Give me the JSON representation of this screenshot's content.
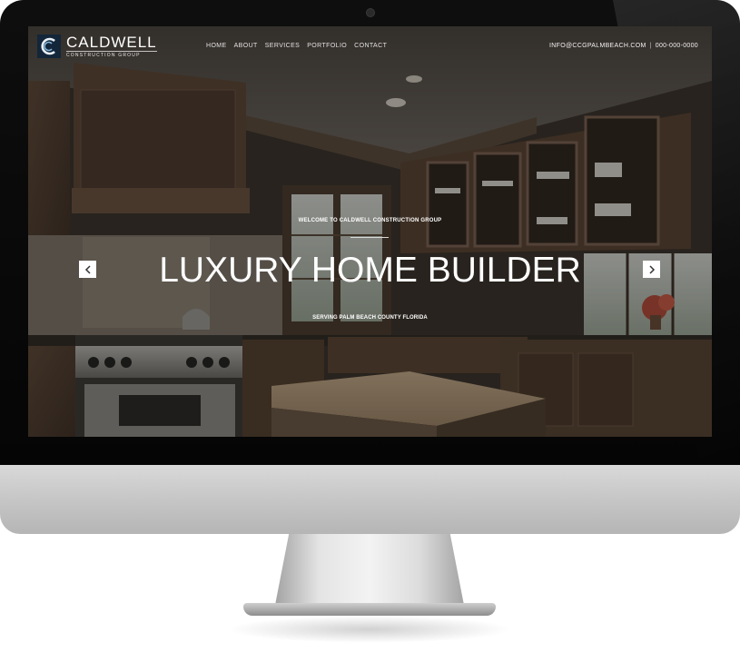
{
  "site": {
    "logo": {
      "name": "CALDWELL",
      "subtitle": "CONSTRUCTION GROUP",
      "icon": "c-monogram-icon"
    },
    "nav": [
      {
        "label": "HOME"
      },
      {
        "label": "ABOUT"
      },
      {
        "label": "SERVICES"
      },
      {
        "label": "PORTFOLIO"
      },
      {
        "label": "CONTACT"
      }
    ],
    "contact": {
      "email": "INFO@CCGPALMBEACH.COM",
      "separator": "|",
      "phone": "000-000-0000"
    },
    "hero": {
      "welcome": "WELCOME TO CALDWELL CONSTRUCTION GROUP",
      "headline": "LUXURY HOME BUILDER",
      "tagline": "SERVING PALM BEACH COUNTY FLORIDA",
      "prev_icon": "chevron-left-icon",
      "next_icon": "chevron-right-icon"
    }
  },
  "colors": {
    "bezel": "#0a0a0a",
    "cabinet": "#5b4636",
    "accent": "#ffffff"
  }
}
